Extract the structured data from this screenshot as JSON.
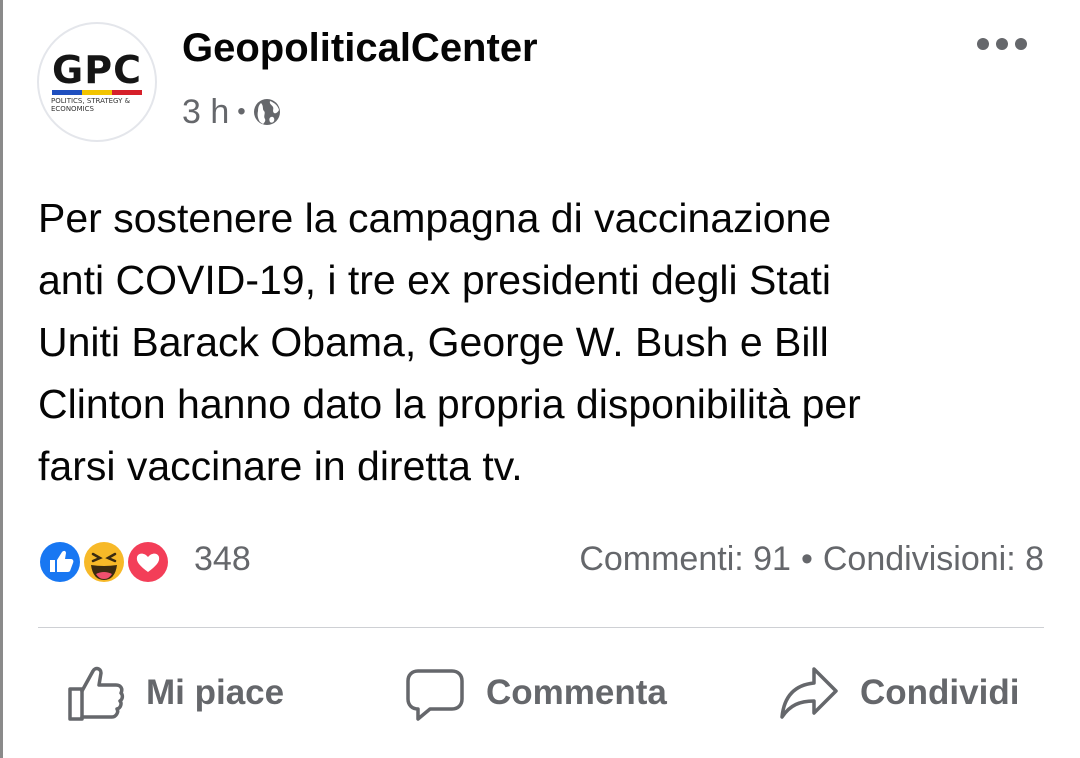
{
  "post": {
    "author": {
      "name": "GeopoliticalCenter",
      "avatar": {
        "letters": "GPC",
        "tagline": "POLITICS, STRATEGY & ECONOMICS",
        "stripe_colors": [
          "#1f4fbf",
          "#f2c400",
          "#d6202a"
        ]
      }
    },
    "time": "3 h",
    "meta_separator": "•",
    "audience_icon": "globe-icon",
    "more_icon": "more-options-icon",
    "text_lines": [
      "Per sostenere la campagna di vaccinazione",
      "anti COVID-19, i tre ex presidenti degli Stati",
      "Uniti Barack Obama, George W. Bush e Bill",
      "Clinton hanno dato la propria disponibilità per",
      "farsi vaccinare in diretta tv."
    ]
  },
  "reactions": {
    "icons": [
      "like-reaction-icon",
      "haha-reaction-icon",
      "love-reaction-icon"
    ],
    "count": "348"
  },
  "stats": {
    "comments": "Commenti: 91",
    "separator": "•",
    "shares": "Condivisioni: 8"
  },
  "actions": {
    "like": {
      "label": "Mi piace",
      "icon": "thumbs-up-icon"
    },
    "comment": {
      "label": "Commenta",
      "icon": "comment-bubble-icon"
    },
    "share": {
      "label": "Condividi",
      "icon": "share-arrow-icon"
    }
  },
  "colors": {
    "text_primary": "#050505",
    "text_secondary": "#65676b",
    "like_blue": "#1877f2",
    "love_red": "#f33e58",
    "haha_yellow": "#f7b928",
    "divider": "#ced0d4"
  }
}
